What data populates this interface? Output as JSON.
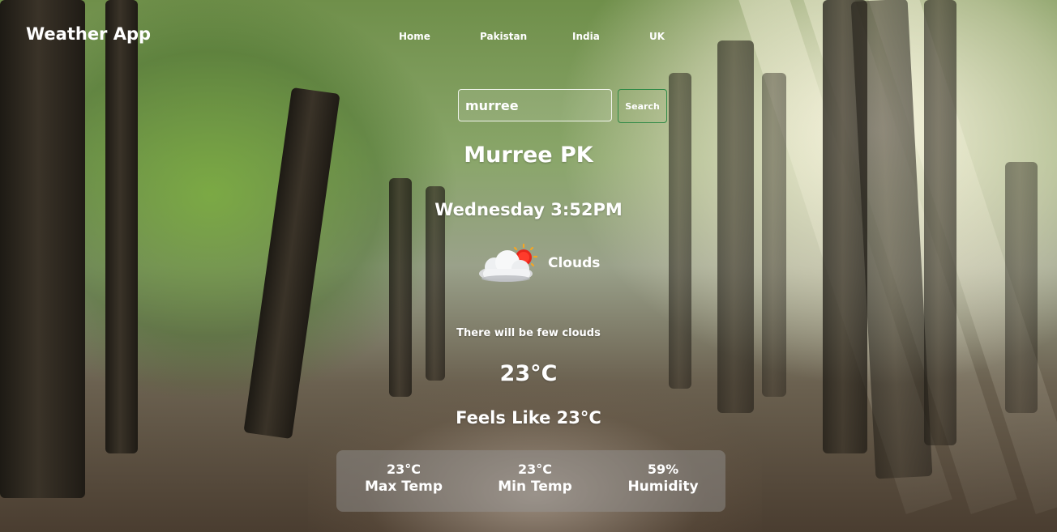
{
  "header": {
    "app_title": "Weather App",
    "nav": [
      "Home",
      "Pakistan",
      "India",
      "UK"
    ]
  },
  "search": {
    "value": "murree",
    "button_label": "Search"
  },
  "weather": {
    "city": "Murree PK",
    "datetime": "Wednesday 3:52PM",
    "condition": "Clouds",
    "condition_icon": "few-clouds-sun-icon",
    "description": "There will be few clouds",
    "temperature": "23°C",
    "feels_like": "Feels Like 23°C"
  },
  "stats": {
    "max_temp_value": "23°C",
    "max_temp_label": "Max Temp",
    "min_temp_value": "23°C",
    "min_temp_label": "Min Temp",
    "humidity_value": "59%",
    "humidity_label": "Humidity"
  }
}
